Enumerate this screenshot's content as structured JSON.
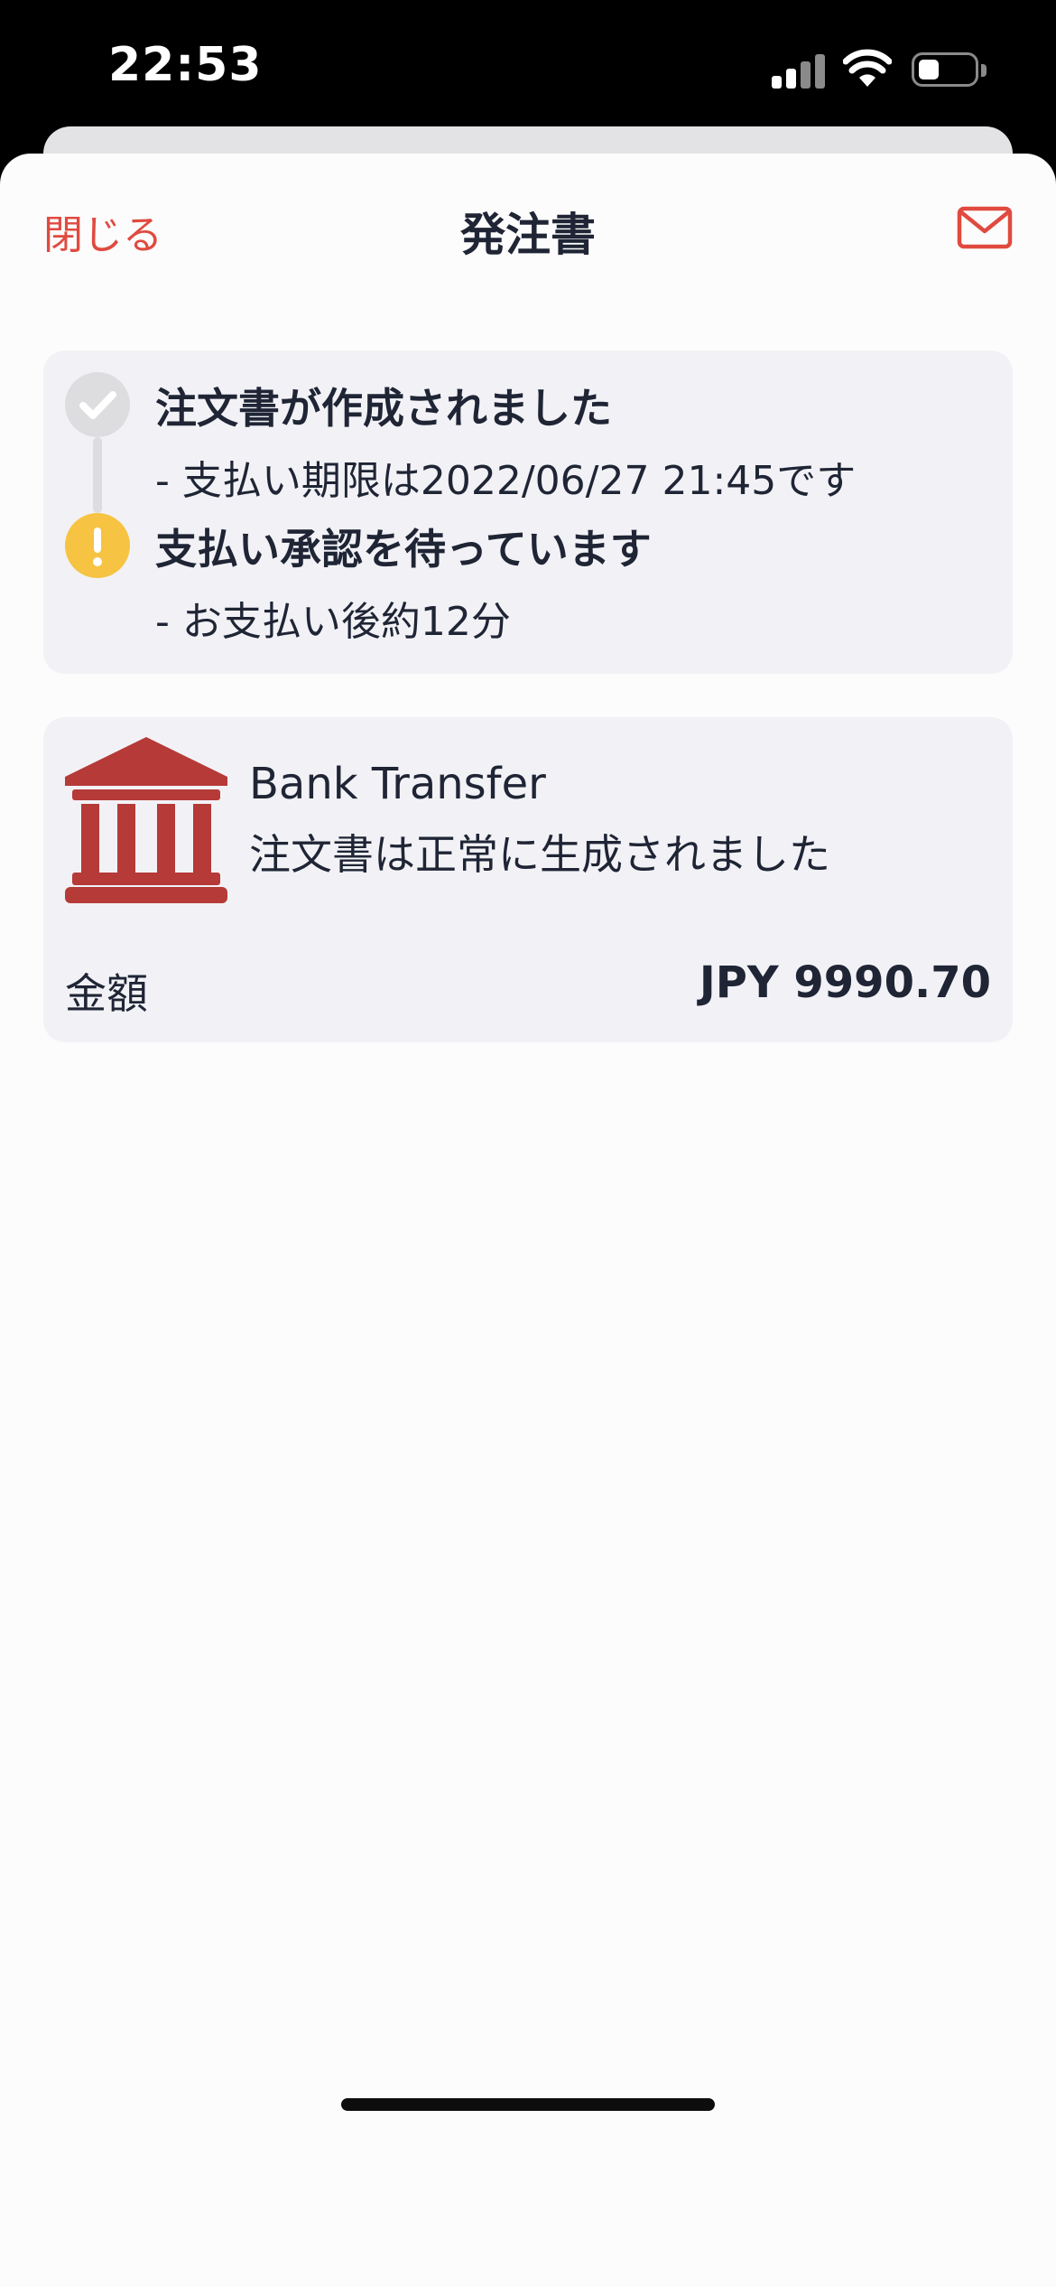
{
  "status_bar": {
    "time": "22:53",
    "icons": [
      "cellular-signal-icon",
      "wifi-icon",
      "battery-icon"
    ]
  },
  "nav": {
    "close_label": "閉じる",
    "title": "発注書",
    "mail_icon": "mail-icon"
  },
  "status": {
    "steps": [
      {
        "title": "注文書が作成されました",
        "subtitle": "- 支払い期限は2022/06/27 21:45です",
        "icon": "check-icon",
        "state": "done"
      },
      {
        "title": "支払い承認を待っています",
        "subtitle": "- お支払い後約12分",
        "icon": "exclamation-icon",
        "state": "pending"
      }
    ]
  },
  "payment": {
    "icon": "bank-icon",
    "method": "Bank Transfer",
    "status": "注文書は正常に生成されました",
    "amount_label": "金額",
    "amount_value": "JPY 9990.70"
  },
  "colors": {
    "accent": "#e04a3f",
    "text": "#1f2535",
    "card_bg": "#f2f2f6",
    "pending": "#f6c342",
    "bank_icon": "#b53a38"
  }
}
